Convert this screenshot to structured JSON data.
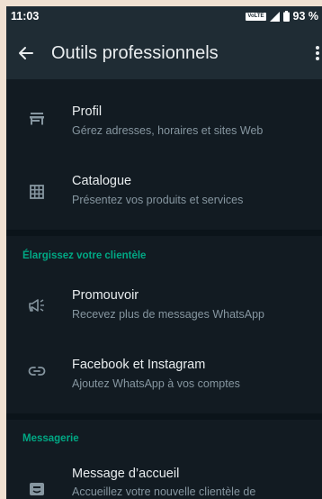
{
  "status_bar": {
    "time": "11:03",
    "network_badge": "VoLTE",
    "battery": "93 %"
  },
  "header": {
    "title": "Outils professionnels"
  },
  "sections": [
    {
      "items": [
        {
          "title": "Profil",
          "subtitle": "Gérez adresses, horaires et sites Web",
          "icon": "storefront-icon"
        },
        {
          "title": "Catalogue",
          "subtitle": "Présentez vos produits et services",
          "icon": "catalog-grid-icon"
        }
      ]
    },
    {
      "header": "Élargissez votre clientèle",
      "items": [
        {
          "title": "Promouvoir",
          "subtitle": "Recevez plus de messages WhatsApp",
          "icon": "megaphone-icon"
        },
        {
          "title": "Facebook et Instagram",
          "subtitle": "Ajoutez WhatsApp à vos comptes",
          "icon": "link-icon"
        }
      ]
    },
    {
      "header": "Messagerie",
      "items": [
        {
          "title": "Message d’accueil",
          "subtitle": "Accueillez votre nouvelle clientèle de",
          "icon": "welcome-message-icon"
        }
      ]
    }
  ],
  "colors": {
    "background": "#121b22",
    "appbar": "#1f2c34",
    "accent": "#00a884",
    "primary_text": "#e9edef",
    "secondary_text": "#8696a0"
  }
}
